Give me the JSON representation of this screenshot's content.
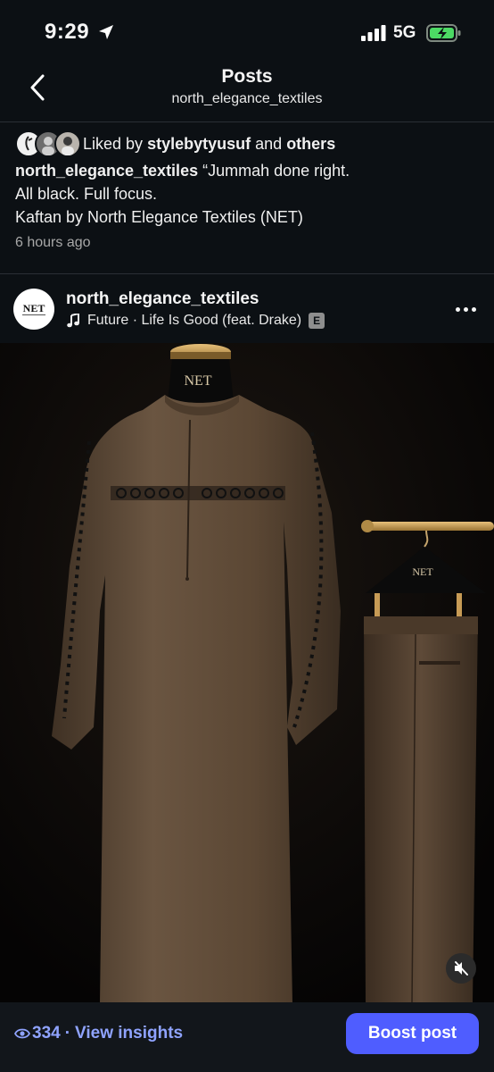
{
  "status_bar": {
    "time": "9:29",
    "network": "5G",
    "icons": [
      "location-arrow-icon",
      "signal-bars-icon",
      "battery-charging-icon"
    ]
  },
  "header": {
    "title": "Posts",
    "subtitle": "north_elegance_textiles"
  },
  "likes": {
    "prefix": "Liked by",
    "user": "stylebytyusuf",
    "conjunction": "and",
    "others": "others"
  },
  "caption": {
    "username": "north_elegance_textiles",
    "lines": [
      "“Jummah done right.",
      "All black. Full focus.",
      "Kaftan by North Elegance Textiles (NET)"
    ],
    "timestamp": "6 hours ago"
  },
  "post": {
    "username": "north_elegance_textiles",
    "avatar_text": "NET",
    "music": "Future · Life Is Good (feat. Drake)",
    "explicit_badge": "E",
    "mannequin_label": "NET",
    "hanger_label": "NET"
  },
  "footer": {
    "views": "334",
    "separator": "·",
    "insights_label": "View insights",
    "boost_label": "Boost post"
  },
  "colors": {
    "background": "#0c1014",
    "accent_link": "#8fa3ff",
    "boost_button": "#4f5dff",
    "garment": "#5e4a38"
  }
}
